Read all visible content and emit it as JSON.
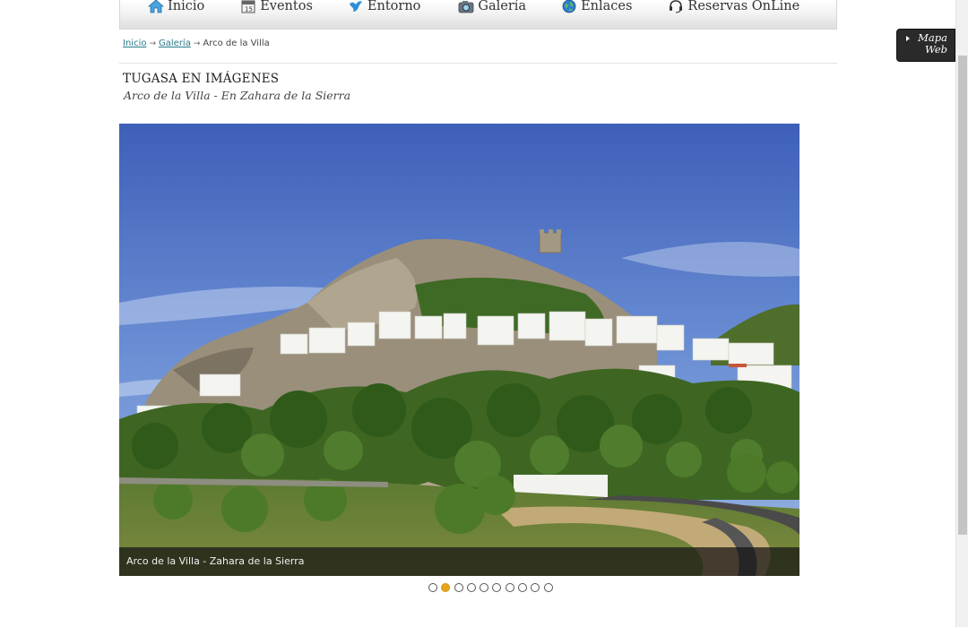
{
  "nav": {
    "items": [
      {
        "label": "Inicio",
        "icon": "home-icon"
      },
      {
        "label": "Eventos",
        "icon": "calendar-icon"
      },
      {
        "label": "Entorno",
        "icon": "bird-icon"
      },
      {
        "label": "Galería",
        "icon": "camera-icon"
      },
      {
        "label": "Enlaces",
        "icon": "globe-icon"
      },
      {
        "label": "Reservas OnLine",
        "icon": "headset-icon"
      }
    ]
  },
  "breadcrumb": {
    "links": [
      "Inicio",
      "Galería"
    ],
    "current": "Arco de la Villa"
  },
  "page": {
    "title": "TUGASA EN IMÁGENES",
    "subtitle": "Arco de la Villa - En Zahara de la Sierra"
  },
  "slideshow": {
    "caption": "Arco de la Villa - Zahara de la Sierra",
    "total_slides": 10,
    "active_slide": 2,
    "active_color": "#e8a416"
  },
  "side_button": {
    "line1": "Mapa",
    "line2": "Web"
  }
}
